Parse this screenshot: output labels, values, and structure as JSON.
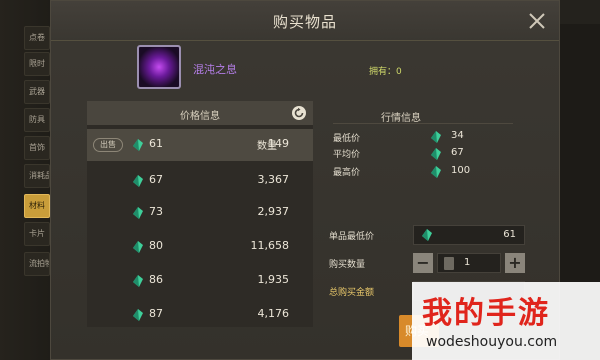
{
  "dialog": {
    "title": "购买物品"
  },
  "item": {
    "name": "混沌之息",
    "owned_label": "拥有：0"
  },
  "sidebar": {
    "items": [
      {
        "label": "点卷"
      },
      {
        "label": "限时"
      },
      {
        "label": "武器"
      },
      {
        "label": "防具"
      },
      {
        "label": "首饰"
      },
      {
        "label": "消耗品"
      },
      {
        "label": "材料"
      },
      {
        "label": "卡片"
      },
      {
        "label": "流拍物品"
      }
    ],
    "active_index": 6
  },
  "price_panel": {
    "header": "价格信息",
    "sell_tag": "出售",
    "qty_label": "数量",
    "rows": [
      {
        "price": "61",
        "qty": "149"
      },
      {
        "price": "67",
        "qty": "3,367"
      },
      {
        "price": "73",
        "qty": "2,937"
      },
      {
        "price": "80",
        "qty": "11,658"
      },
      {
        "price": "86",
        "qty": "1,935"
      },
      {
        "price": "87",
        "qty": "4,176"
      }
    ]
  },
  "market": {
    "title": "行情信息",
    "lowest_label": "最低价",
    "lowest_value": "34",
    "average_label": "平均价",
    "average_value": "67",
    "highest_label": "最高价",
    "highest_value": "100"
  },
  "purchase": {
    "unit_min_label": "单品最低价",
    "unit_min_value": "61",
    "qty_label": "购买数量",
    "qty_value": "1",
    "minus": "−",
    "plus": "+",
    "total_label": "总购买金额",
    "buy_label": "购买"
  },
  "watermark": {
    "title": "我的手游",
    "url": "wodeshouyou.com"
  },
  "colors": {
    "accent_gold": "#c99d3a",
    "gem": "#3fcf9a",
    "item_name": "#b57ee8",
    "buy": "#d88a2a"
  },
  "icons": {
    "close": "close-icon",
    "refresh": "refresh-icon",
    "gem": "gem-icon"
  }
}
